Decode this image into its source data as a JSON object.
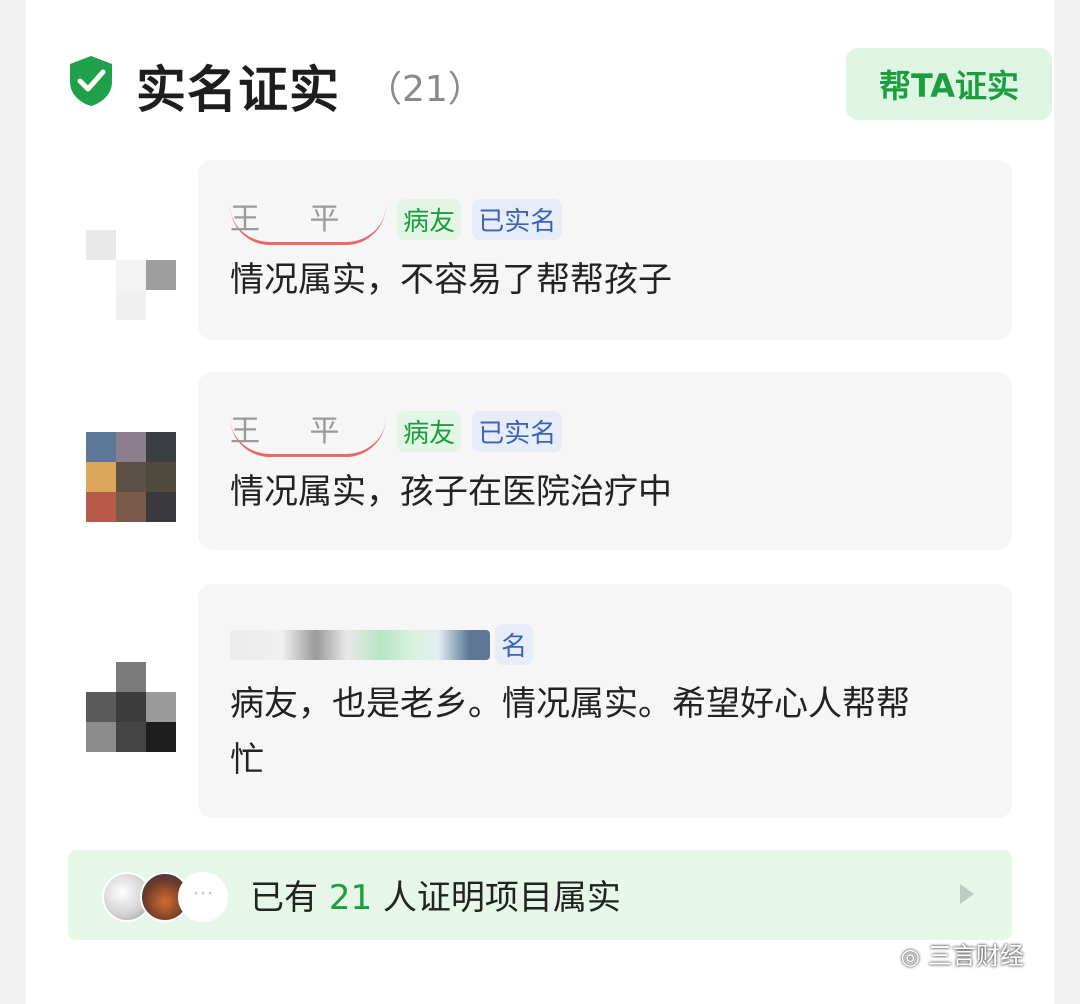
{
  "section": {
    "title": "实名证实",
    "count": "（21）",
    "help_button": "帮TA证实"
  },
  "comments": [
    {
      "name": "王 平",
      "tags": [
        "病友",
        "已实名"
      ],
      "text": "情况属实，不容易了帮帮孩子",
      "avatar_colors": [
        "#e9e9e9",
        "#ffffff",
        "#ffffff",
        "#ffffff",
        "#f3f3f3",
        "#9e9e9e",
        "#ffffff",
        "#f0f0f0",
        "#ffffff"
      ]
    },
    {
      "name": "王 平",
      "tags": [
        "病友",
        "已实名"
      ],
      "text": "情况属实，孩子在医院治疗中",
      "avatar_colors": [
        "#5d7796",
        "#8d7e8e",
        "#3b3f44",
        "#d9a65a",
        "#5a5048",
        "#50493d",
        "#b85a48",
        "#7a5a4a",
        "#3a3a3c"
      ]
    },
    {
      "tag_partial": "名",
      "text_line1": "病友，也是老乡。情况属实。希望好心人帮帮",
      "text_line2": "忙",
      "avatar_colors": [
        "#ffffff",
        "#7a7a7a",
        "#ffffff",
        "#5a5a5a",
        "#3c3c3c",
        "#9a9a9a",
        "#8c8c8c",
        "#444444",
        "#1e1e1e"
      ]
    }
  ],
  "footer": {
    "prefix": "已有",
    "number": "21",
    "suffix": "人证明项目属实",
    "more_dots": "···"
  },
  "watermark": {
    "icon": "wechat-icon",
    "text": "三言财经"
  },
  "colors": {
    "accent_green": "#1a9e3f",
    "tag_blue": "#3c63b8",
    "bubble_bg": "#f6f6f6"
  }
}
